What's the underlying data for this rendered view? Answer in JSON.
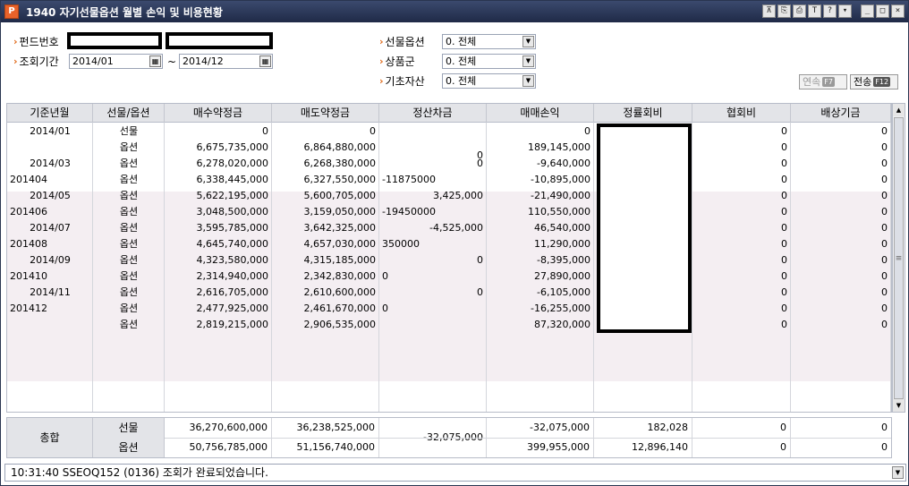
{
  "window": {
    "title": "1940 자기선물옵션 월별 손익 및 비용현황",
    "app_icon": "P",
    "toolbar_icons": [
      "pin-icon",
      "copy-icon",
      "print-icon",
      "text-icon",
      "help-icon",
      "dropdown-icon"
    ],
    "controls": [
      "minimize",
      "maximize",
      "close"
    ]
  },
  "form": {
    "fund_no_label": "펀드번호",
    "period_label": "조회기간",
    "period_from": "2014/01",
    "period_to": "2014/12",
    "tilde": "~",
    "futopt_label": "선물옵션",
    "futopt_value": "0. 전체",
    "product_label": "상품군",
    "product_value": "0. 전체",
    "underlying_label": "기초자산",
    "underlying_value": "0. 전체",
    "continue_label": "연속",
    "continue_key": "F7",
    "send_label": "전송",
    "send_key": "F12"
  },
  "grid": {
    "headers": [
      "기준년월",
      "선물/옵션",
      "매수약정금",
      "매도약정금",
      "정산차금",
      "매매손익",
      "정률회비",
      "협회비",
      "배상기금"
    ],
    "rows": [
      [
        "2014/01",
        "선물",
        "0",
        "0",
        "",
        "0",
        "",
        "0",
        "0"
      ],
      [
        "",
        "옵션",
        "6,675,735,000",
        "6,864,880,000",
        "0",
        "189,145,000",
        "",
        "0",
        "0"
      ],
      [
        "2014/03",
        "옵션",
        "6,278,020,000",
        "6,268,380,000",
        "0",
        "-9,640,000",
        "",
        "0",
        "0"
      ],
      [
        "201404",
        "옵션",
        "6,338,445,000",
        "6,327,550,000",
        "-11875000",
        "-10,895,000",
        "",
        "0",
        "0"
      ],
      [
        "2014/05",
        "옵션",
        "5,622,195,000",
        "5,600,705,000",
        "3,425,000",
        "-21,490,000",
        "",
        "0",
        "0"
      ],
      [
        "201406",
        "옵션",
        "3,048,500,000",
        "3,159,050,000",
        "-19450000",
        "110,550,000",
        "",
        "0",
        "0"
      ],
      [
        "2014/07",
        "옵션",
        "3,595,785,000",
        "3,642,325,000",
        "-4,525,000",
        "46,540,000",
        "",
        "0",
        "0"
      ],
      [
        "201408",
        "옵션",
        "4,645,740,000",
        "4,657,030,000",
        "350000",
        "11,290,000",
        "",
        "0",
        "0"
      ],
      [
        "2014/09",
        "옵션",
        "4,323,580,000",
        "4,315,185,000",
        "0",
        "-8,395,000",
        "",
        "0",
        "0"
      ],
      [
        "201410",
        "옵션",
        "2,314,940,000",
        "2,342,830,000",
        "0",
        "27,890,000",
        "",
        "0",
        "0"
      ],
      [
        "2014/11",
        "옵션",
        "2,616,705,000",
        "2,610,600,000",
        "0",
        "-6,105,000",
        "",
        "0",
        "0"
      ],
      [
        "201412",
        "옵션",
        "2,477,925,000",
        "2,461,670,000",
        "0",
        "-16,255,000",
        "",
        "0",
        "0"
      ],
      [
        "",
        "옵션",
        "2,819,215,000",
        "2,906,535,000",
        "",
        "87,320,000",
        "",
        "0",
        "0"
      ]
    ]
  },
  "totals": {
    "label": "총합",
    "fut_label": "선물",
    "opt_label": "옵션",
    "fut": [
      "36,270,600,000",
      "36,238,525,000",
      "-32,075,000",
      "182,028",
      "0",
      "0"
    ],
    "opt": [
      "50,756,785,000",
      "51,156,740,000",
      "399,955,000",
      "12,896,140",
      "0",
      "0"
    ],
    "settle": "-32,075,000"
  },
  "status": {
    "message": "10:31:40 SSEOQ152 (0136) 조회가 완료되었습니다."
  }
}
